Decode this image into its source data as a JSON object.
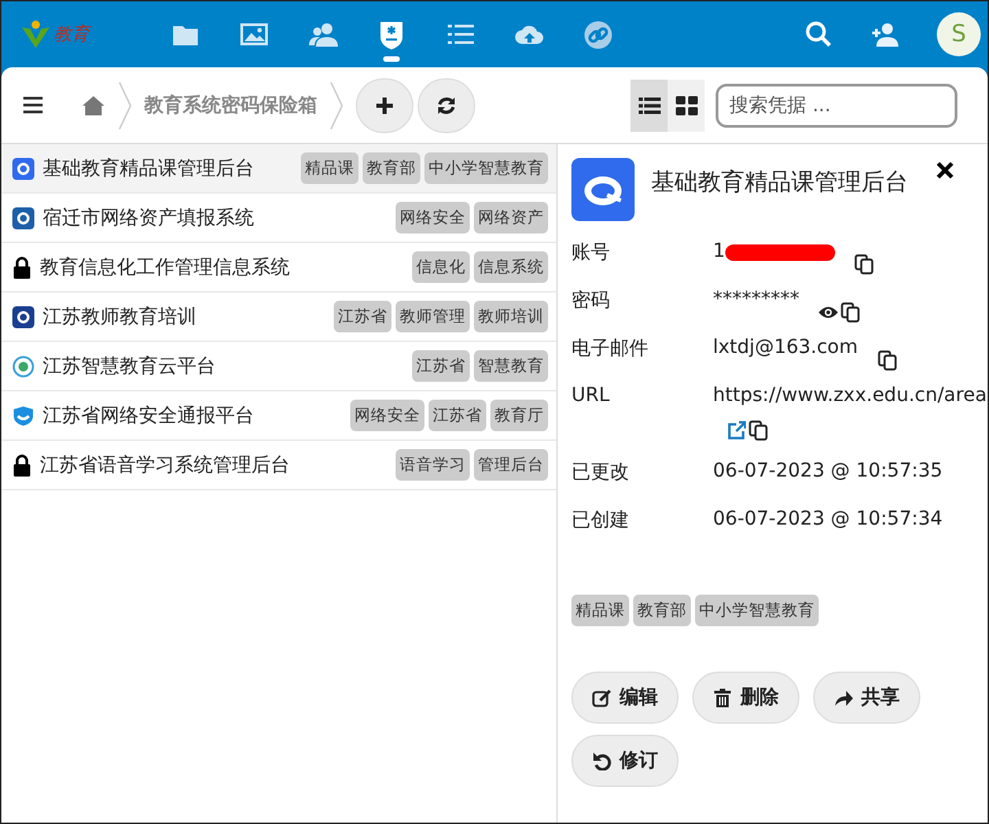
{
  "header": {
    "logo_text": "教育",
    "nav": [
      {
        "kind": "folder",
        "selected": false
      },
      {
        "kind": "image",
        "selected": false
      },
      {
        "kind": "people",
        "selected": false
      },
      {
        "kind": "vault",
        "selected": true
      },
      {
        "kind": "list",
        "selected": false
      },
      {
        "kind": "upload",
        "selected": false
      },
      {
        "kind": "link",
        "selected": false
      }
    ],
    "avatar": "S"
  },
  "toolbar": {
    "breadcrumb": "教育系统密码保险箱",
    "views": [
      {
        "kind": "list",
        "selected": true
      },
      {
        "kind": "grid",
        "selected": false
      }
    ],
    "search": {
      "placeholder": "搜索凭据 ..."
    }
  },
  "credentials": [
    {
      "name": "基础教育精品课管理后台",
      "kind": "site",
      "color": "#2f6bec",
      "selected": true,
      "tags": [
        "精品课",
        "教育部",
        "中小学智慧教育"
      ]
    },
    {
      "name": "宿迁市网络资产填报系统",
      "kind": "site",
      "color": "#1d5fa8",
      "selected": false,
      "tags": [
        "网络安全",
        "网络资产"
      ]
    },
    {
      "name": "教育信息化工作管理信息系统",
      "kind": "lock",
      "selected": false,
      "tags": [
        "信息化",
        "信息系统"
      ]
    },
    {
      "name": "江苏教师教育培训",
      "kind": "site",
      "color": "#1a3f8f",
      "selected": false,
      "tags": [
        "江苏省",
        "教师管理",
        "教师培训"
      ]
    },
    {
      "name": "江苏智慧教育云平台",
      "kind": "ring",
      "color": "#3aa0d8",
      "selected": false,
      "tags": [
        "江苏省",
        "智慧教育"
      ]
    },
    {
      "name": "江苏省网络安全通报平台",
      "kind": "shield",
      "color": "#1c8fe0",
      "selected": false,
      "tags": [
        "网络安全",
        "江苏省",
        "教育厅"
      ]
    },
    {
      "name": "江苏省语音学习系统管理后台",
      "kind": "lock",
      "selected": false,
      "tags": [
        "语音学习",
        "管理后台"
      ]
    }
  ],
  "detail": {
    "title": "基础教育精品课管理后台",
    "fields": [
      {
        "label": "账号",
        "value": "1",
        "redacted": true,
        "copyable": true
      },
      {
        "label": "密码",
        "value": "*********",
        "revealable": true,
        "copyable": true
      },
      {
        "label": "电子邮件",
        "value": "lxtdj@163.com",
        "copyable": true
      },
      {
        "label": "URL",
        "value": "https://www.zxx.edu.cn/area",
        "openable": true,
        "copyable": true
      }
    ],
    "dates": [
      {
        "label": "已更改",
        "value": "06-07-2023 @ 10:57:35"
      },
      {
        "label": "已创建",
        "value": "06-07-2023 @ 10:57:34"
      }
    ],
    "tags": [
      "精品课",
      "教育部",
      "中小学智慧教育"
    ],
    "buttons": [
      {
        "kind": "edit",
        "label": "编辑"
      },
      {
        "kind": "delete",
        "label": "删除"
      },
      {
        "kind": "share",
        "label": "共享"
      },
      {
        "kind": "revisions",
        "label": "修订"
      }
    ]
  }
}
